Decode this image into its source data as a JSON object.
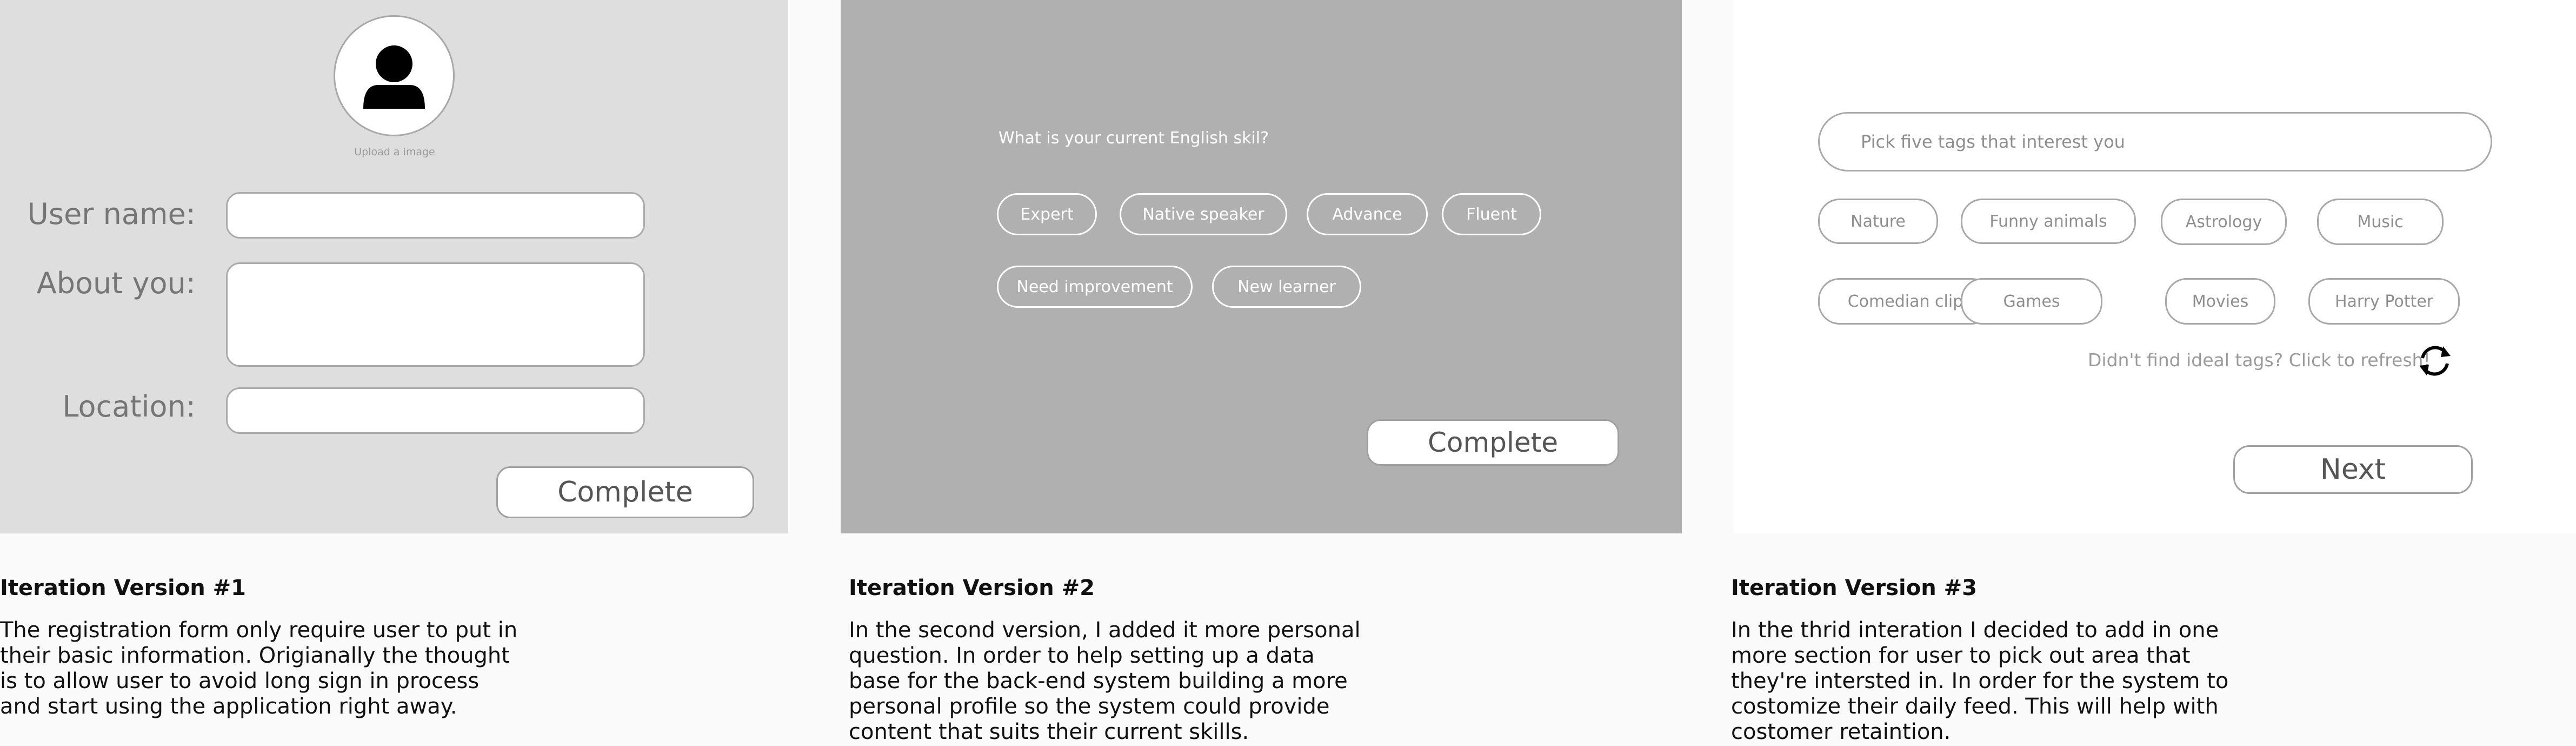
{
  "panel1": {
    "avatar_icon": "user-avatar-icon",
    "upload_label": "Upload a image",
    "fields": {
      "username_label": "User name:",
      "about_label": "About you:",
      "location_label": "Location:"
    },
    "complete_label": "Complete"
  },
  "panel2": {
    "question": "What is your current English skil?",
    "options": [
      "Expert",
      "Native speaker",
      "Advance",
      "Fluent",
      "Need improvement",
      "New learner"
    ],
    "complete_label": "Complete"
  },
  "panel3": {
    "search_placeholder": "Pick five tags that interest you",
    "tags": [
      "Nature",
      "Funny animals",
      "Astrology",
      "Music",
      "Comedian clip",
      "Games",
      "Movies",
      "Harry Potter"
    ],
    "refresh_text": "Didn't find ideal tags? Click to refresh!",
    "refresh_icon": "refresh-icon",
    "next_label": "Next"
  },
  "captions": [
    {
      "title": "Iteration Version #1",
      "body": "The registration form only require user to put in their basic information. Origianally the thought is to allow user to avoid long sign in process and start using the application right away."
    },
    {
      "title": "Iteration Version #2",
      "body": "In the second version, I added it more personal question. In order to help setting up a data base for the back-end system building a more personal profile so the system could provide content that suits their current skills."
    },
    {
      "title": "Iteration Version #3",
      "body": "In the thrid interation I decided to add in one more section for user to pick out area that they're intersted in. In order for the system to costomize their daily feed. This will help with costomer retaintion."
    }
  ],
  "colors": {
    "panel1_bg": "#dedede",
    "panel2_bg": "#b0b0b0",
    "panel3_bg": "#ffffff",
    "page_bg": "#fafafa"
  }
}
